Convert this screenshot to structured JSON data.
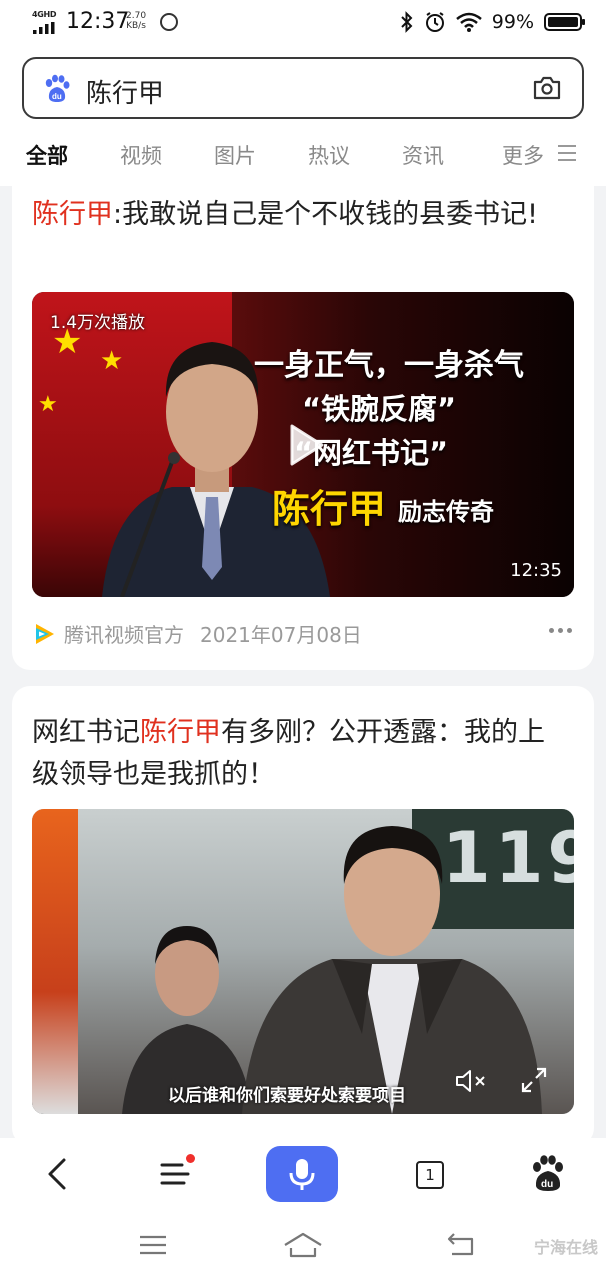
{
  "status_bar": {
    "network": "4GHD",
    "time": "12:37",
    "speed_value": "2.70",
    "speed_unit": "KB/s",
    "battery_pct": "99%",
    "battery_level": 0.99
  },
  "search": {
    "query": "陈行甲"
  },
  "tabs": [
    {
      "label": "全部",
      "active": true
    },
    {
      "label": "视频",
      "active": false
    },
    {
      "label": "图片",
      "active": false
    },
    {
      "label": "热议",
      "active": false
    },
    {
      "label": "资讯",
      "active": false
    },
    {
      "label": "更多",
      "active": false
    }
  ],
  "results": [
    {
      "title_highlight": "陈行甲",
      "title_rest": ":我敢说自己是个不收钱的县委书记!",
      "video": {
        "plays": "1.4万次播放",
        "duration": "12:35",
        "overlay_lines": [
          "一身正气，一身杀气",
          "“铁腕反腐”",
          "“网红书记”",
          "陈行甲",
          "励志传奇"
        ]
      },
      "source": "腾讯视频官方",
      "date": "2021年07月08日"
    },
    {
      "title_prefix": "网红书记",
      "title_highlight": "陈行甲",
      "title_rest": "有多刚？公开透露：我的上级领导也是我抓的！",
      "video": {
        "board_number": "119",
        "subtitle": "以后谁和你们索要好处索要项目"
      }
    }
  ],
  "toolbar": {
    "tabs_count": "1"
  },
  "watermark": "宁海在线",
  "colors": {
    "accent": "#4e6ef2",
    "highlight": "#e0311f",
    "notification_dot": "#f0302c"
  }
}
